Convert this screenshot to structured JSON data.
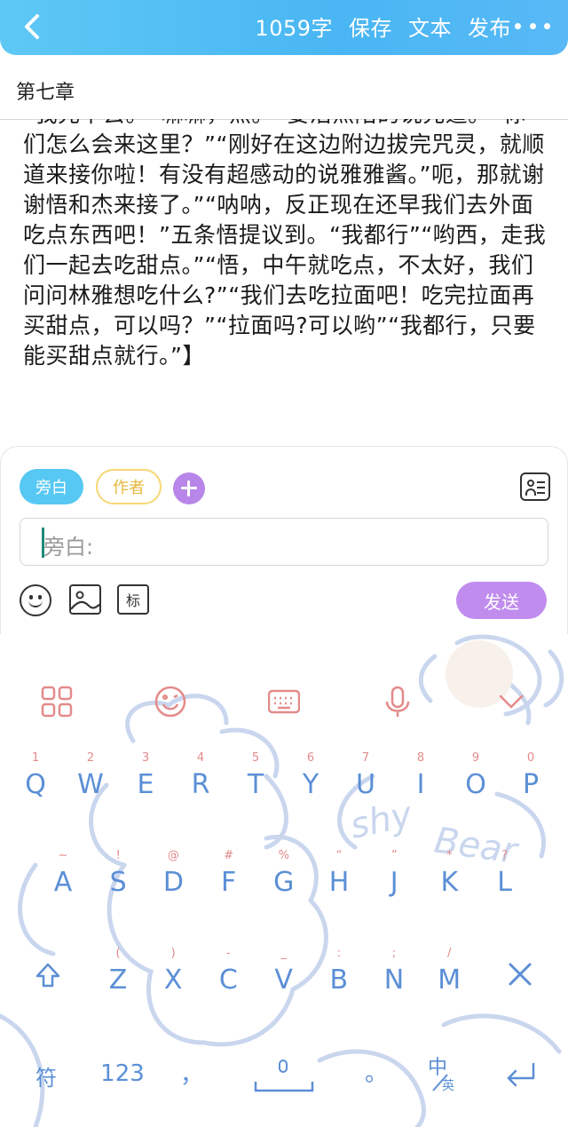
{
  "topbar": {
    "word_count": "1059字",
    "save_label": "保存",
    "text_label": "文本",
    "publish_label": "发布",
    "more_icon": "more-dots-icon",
    "back_icon": "chevron-left-icon"
  },
  "chapter_title": "第七章",
  "story_text": "“我先下去。”“嘛嘛，杰。”“要活杰陪的说先道。”“你们怎么会来这里？”“刚好在这边附边拔完咒灵，就顺道来接你啦！有没有超感动的说雅雅酱。”呃，那就谢谢悟和杰来接了。”“呐呐，反正现在还早我们去外面吃点东西吧！”五条悟提议到。“我都行”“哟西，走我们一起去吃甜点。”“悟，中午就吃点，不太好，我们问问林雅想吃什么?”“我们去吃拉面吧！吃完拉面再买甜点，可以吗？”“拉面吗?可以哟”“我都行，只要能买甜点就行。”】",
  "composer": {
    "tag_narration": "旁白",
    "tag_author": "作者",
    "input_placeholder": "旁白:",
    "mark_label": "标",
    "send_label": "发送"
  },
  "keyboard": {
    "row1": [
      "Q",
      "W",
      "E",
      "R",
      "T",
      "Y",
      "U",
      "I",
      "O",
      "P"
    ],
    "row1_hints": [
      "1",
      "2",
      "3",
      "4",
      "5",
      "6",
      "7",
      "8",
      "9",
      "0"
    ],
    "row2": [
      "A",
      "S",
      "D",
      "F",
      "G",
      "H",
      "J",
      "K",
      "L"
    ],
    "row2_hints": [
      "~",
      "!",
      "@",
      "#",
      "%",
      "“",
      "”",
      "*",
      "?"
    ],
    "row3": [
      "Z",
      "X",
      "C",
      "V",
      "B",
      "N",
      "M"
    ],
    "row3_hints": [
      "(",
      ")",
      "-",
      "_",
      ":",
      ";",
      "/"
    ],
    "symbol_label": "符",
    "num_label": "123",
    "comma_label": "，",
    "period_label": "。",
    "lang_main": "中",
    "lang_sub": "英",
    "bg_text_1": "shy",
    "bg_text_2": "Bear"
  },
  "colors": {
    "topbar": "#4fb9f4",
    "narration_tag": "#56c8f3",
    "author_tag": "#f6d774",
    "send": "#c08cee",
    "key_text": "#5b8fd6",
    "key_hint": "#e48a8a"
  }
}
